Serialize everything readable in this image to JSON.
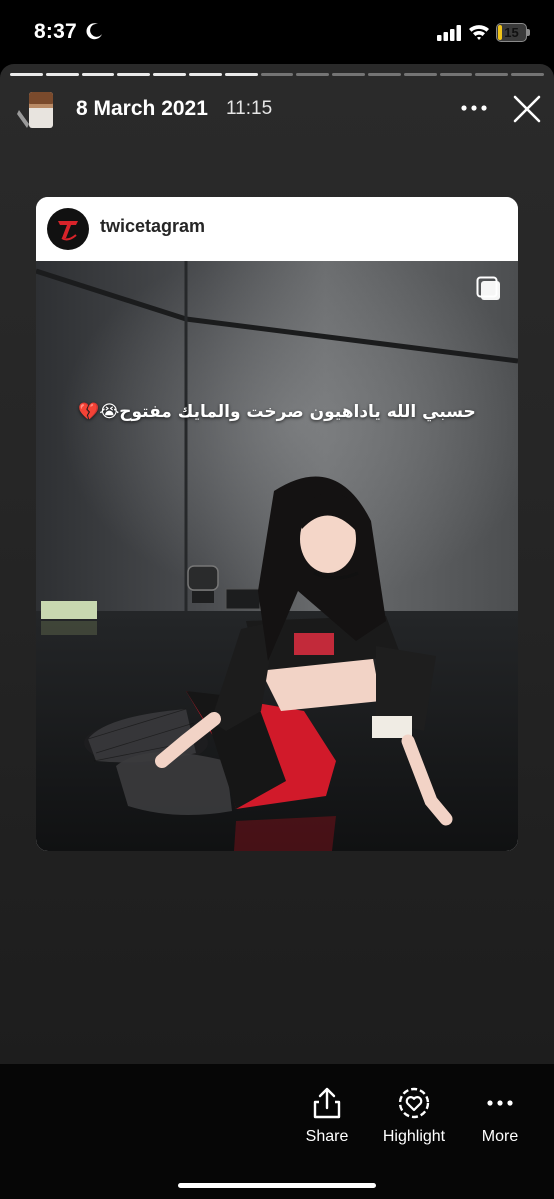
{
  "status_bar": {
    "time": "8:37",
    "battery_level": "15",
    "battery_fraction": 0.15,
    "battery_color": "#f0c419",
    "icons": [
      "moon-icon",
      "cellular-signal-icon",
      "wifi-icon",
      "battery-icon"
    ]
  },
  "story": {
    "progress_segments_total": 15,
    "progress_segments_viewed": 7,
    "date": "8 March 2021",
    "time": "11:15",
    "icons": [
      "more-options-icon",
      "close-icon"
    ]
  },
  "post": {
    "username": "twicetagram",
    "caption": "حسبي الله ياداهيون صرخت والمايك مفتوح😭💔",
    "icons": [
      "twice-logo",
      "multiple-photos-icon"
    ]
  },
  "actions": [
    {
      "label": "Share",
      "icon": "share-icon"
    },
    {
      "label": "Highlight",
      "icon": "highlight-heart-icon"
    },
    {
      "label": "More",
      "icon": "more-horizontal-icon"
    }
  ],
  "colors": {
    "background": "#000000",
    "story_background": "#262626",
    "post_header": "#ffffff",
    "skirt_red": "#d11a2a"
  }
}
